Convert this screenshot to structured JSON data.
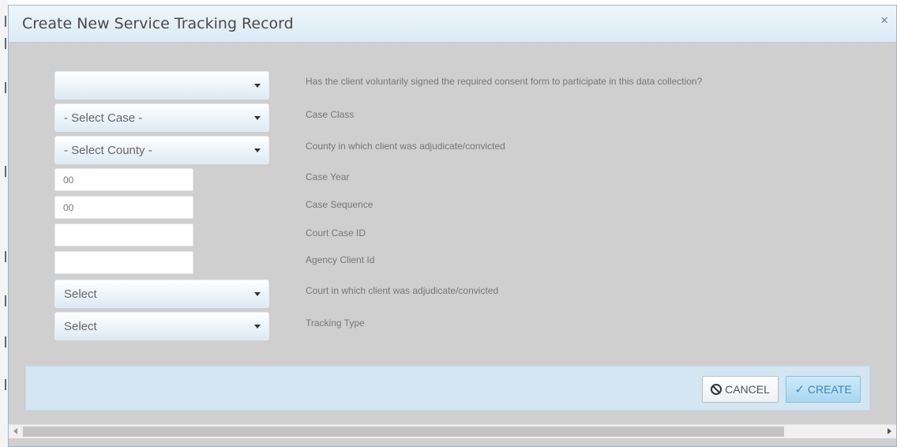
{
  "dialog": {
    "title": "Create New Service Tracking Record",
    "close_symbol": "×"
  },
  "fields": [
    {
      "type": "select",
      "value": "",
      "label": "Has the client voluntarily signed the required consent form to participate in this data collection?"
    },
    {
      "type": "select",
      "value": "- Select Case -",
      "label": "Case Class"
    },
    {
      "type": "select",
      "value": "- Select County -",
      "label": "County in which client was adjudicate/convicted"
    },
    {
      "type": "input",
      "value": "00",
      "label": "Case Year"
    },
    {
      "type": "input",
      "value": "00",
      "label": "Case Sequence"
    },
    {
      "type": "input",
      "value": "",
      "label": "Court Case ID"
    },
    {
      "type": "input",
      "value": "",
      "label": "Agency Client Id"
    },
    {
      "type": "select",
      "value": "Select",
      "label": "Court in which client was adjudicate/convicted"
    },
    {
      "type": "select",
      "value": "Select",
      "label": "Tracking Type"
    }
  ],
  "footer": {
    "cancel_label": "CANCEL",
    "create_label": "CREATE",
    "cancel_icon": "ban-icon",
    "create_icon": "check-icon",
    "create_color": "#3a87bf"
  }
}
